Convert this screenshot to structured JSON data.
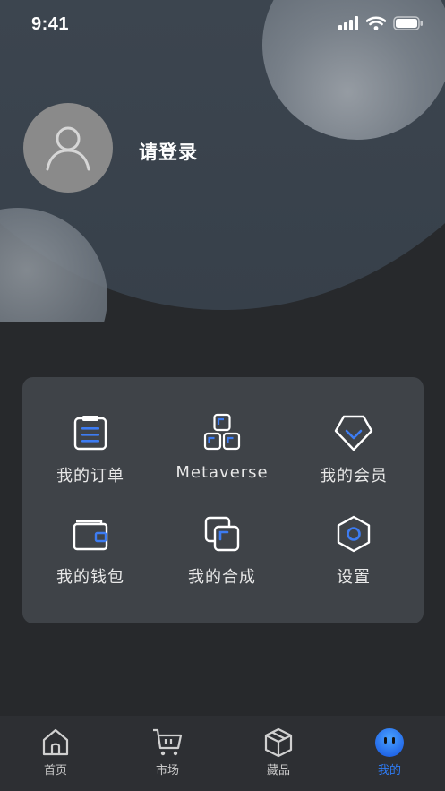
{
  "status_bar": {
    "time": "9:41"
  },
  "profile": {
    "login_label": "请登录"
  },
  "menu": {
    "items": [
      {
        "label": "我的订单",
        "icon": "order-list-icon"
      },
      {
        "label": "Metaverse",
        "icon": "metaverse-blocks-icon"
      },
      {
        "label": "我的会员",
        "icon": "membership-diamond-icon"
      },
      {
        "label": "我的钱包",
        "icon": "wallet-icon"
      },
      {
        "label": "我的合成",
        "icon": "synthesis-icon"
      },
      {
        "label": "设置",
        "icon": "settings-hexagon-icon"
      }
    ]
  },
  "tabbar": {
    "items": [
      {
        "label": "首页",
        "icon": "home-icon"
      },
      {
        "label": "市场",
        "icon": "cart-icon"
      },
      {
        "label": "藏品",
        "icon": "box-icon"
      },
      {
        "label": "我的",
        "icon": "profile-face-icon",
        "active": true
      }
    ]
  },
  "colors": {
    "accent": "#2e7cf6",
    "card": "#3f4348",
    "background": "#27292c",
    "tabbar": "#2d2f33"
  }
}
